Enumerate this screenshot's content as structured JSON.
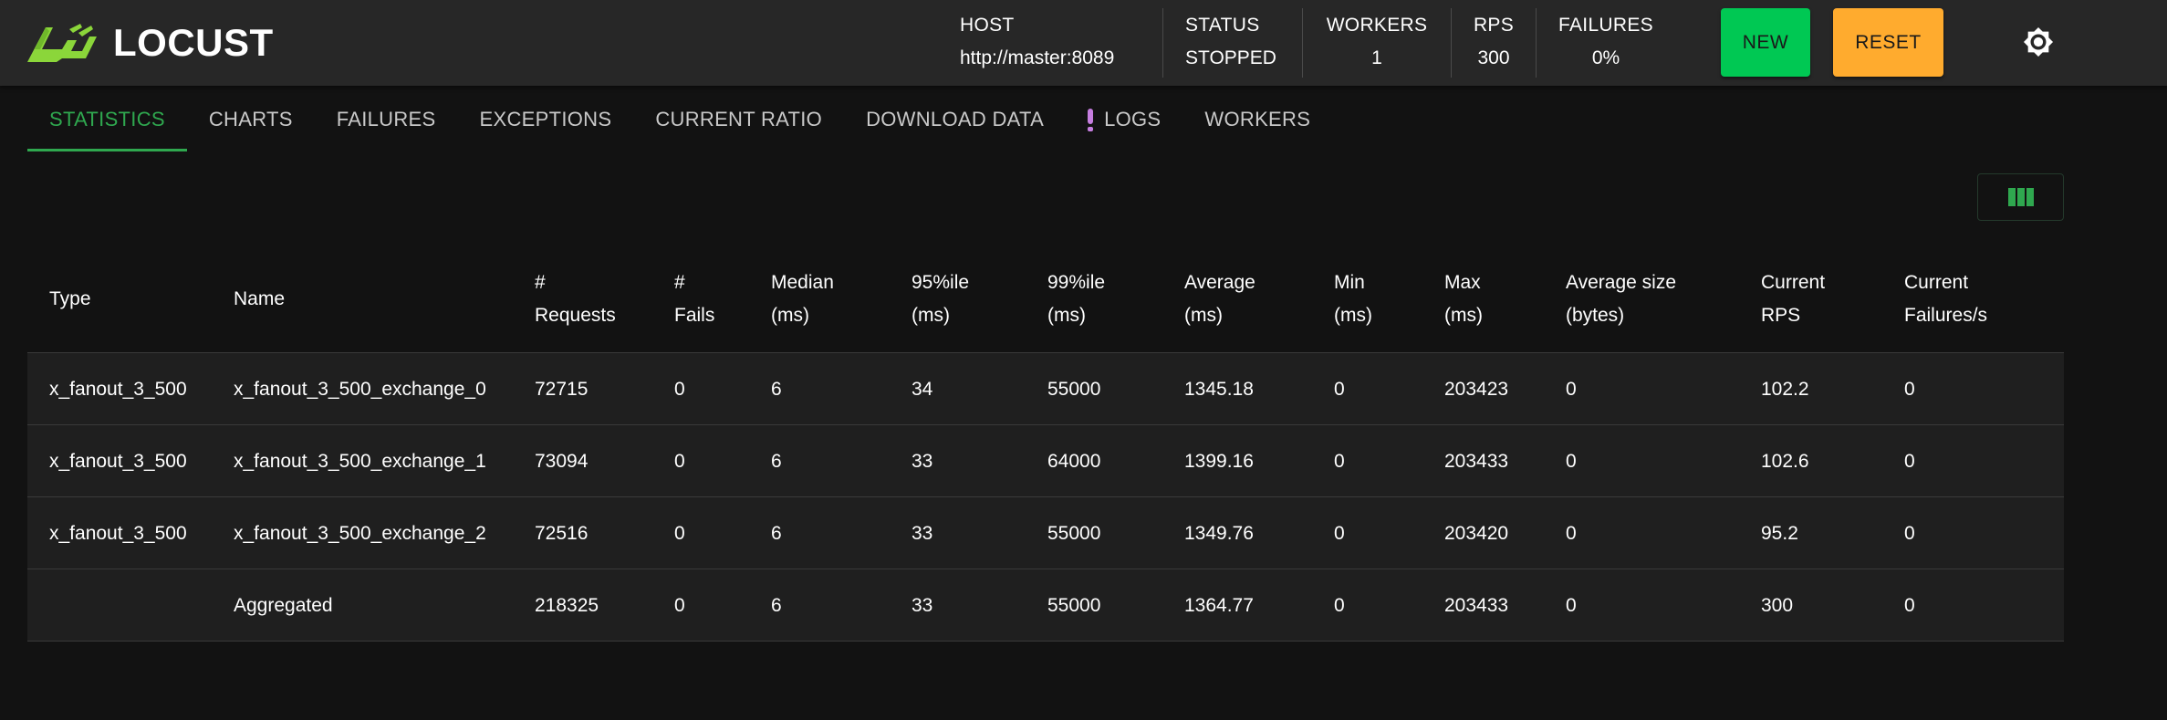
{
  "app": {
    "logo_text": "LOCUST",
    "colors": {
      "accent_green": "#2fa84f",
      "new_button": "#00c853",
      "reset_button": "#ffab2e",
      "logs_alert": "#c67ee0",
      "header_bg": "#272727",
      "page_bg": "#121212"
    }
  },
  "header": {
    "host": {
      "label": "HOST",
      "value": "http://master:8089"
    },
    "status": {
      "label": "STATUS",
      "value": "STOPPED"
    },
    "workers": {
      "label": "WORKERS",
      "value": "1"
    },
    "rps": {
      "label": "RPS",
      "value": "300"
    },
    "failures": {
      "label": "FAILURES",
      "value": "0%"
    },
    "new_label": "NEW",
    "reset_label": "RESET",
    "theme_icon": "sun-icon"
  },
  "tabs": [
    {
      "label": "STATISTICS",
      "active": true
    },
    {
      "label": "CHARTS"
    },
    {
      "label": "FAILURES"
    },
    {
      "label": "EXCEPTIONS"
    },
    {
      "label": "CURRENT RATIO"
    },
    {
      "label": "DOWNLOAD DATA"
    },
    {
      "label": "LOGS",
      "icon": "alert-icon"
    },
    {
      "label": "WORKERS"
    }
  ],
  "table": {
    "columns_icon": "view-column-icon",
    "headers": [
      "Type",
      "Name",
      "#\nRequests",
      "#\nFails",
      "Median\n(ms)",
      "95%ile\n(ms)",
      "99%ile\n(ms)",
      "Average\n(ms)",
      "Min\n(ms)",
      "Max\n(ms)",
      "Average size\n(bytes)",
      "Current\nRPS",
      "Current\nFailures/s"
    ],
    "rows": [
      [
        "x_fanout_3_500",
        "x_fanout_3_500_exchange_0",
        "72715",
        "0",
        "6",
        "34",
        "55000",
        "1345.18",
        "0",
        "203423",
        "0",
        "102.2",
        "0"
      ],
      [
        "x_fanout_3_500",
        "x_fanout_3_500_exchange_1",
        "73094",
        "0",
        "6",
        "33",
        "64000",
        "1399.16",
        "0",
        "203433",
        "0",
        "102.6",
        "0"
      ],
      [
        "x_fanout_3_500",
        "x_fanout_3_500_exchange_2",
        "72516",
        "0",
        "6",
        "33",
        "55000",
        "1349.76",
        "0",
        "203420",
        "0",
        "95.2",
        "0"
      ],
      [
        "",
        "Aggregated",
        "218325",
        "0",
        "6",
        "33",
        "55000",
        "1364.77",
        "0",
        "203433",
        "0",
        "300",
        "0"
      ]
    ]
  }
}
